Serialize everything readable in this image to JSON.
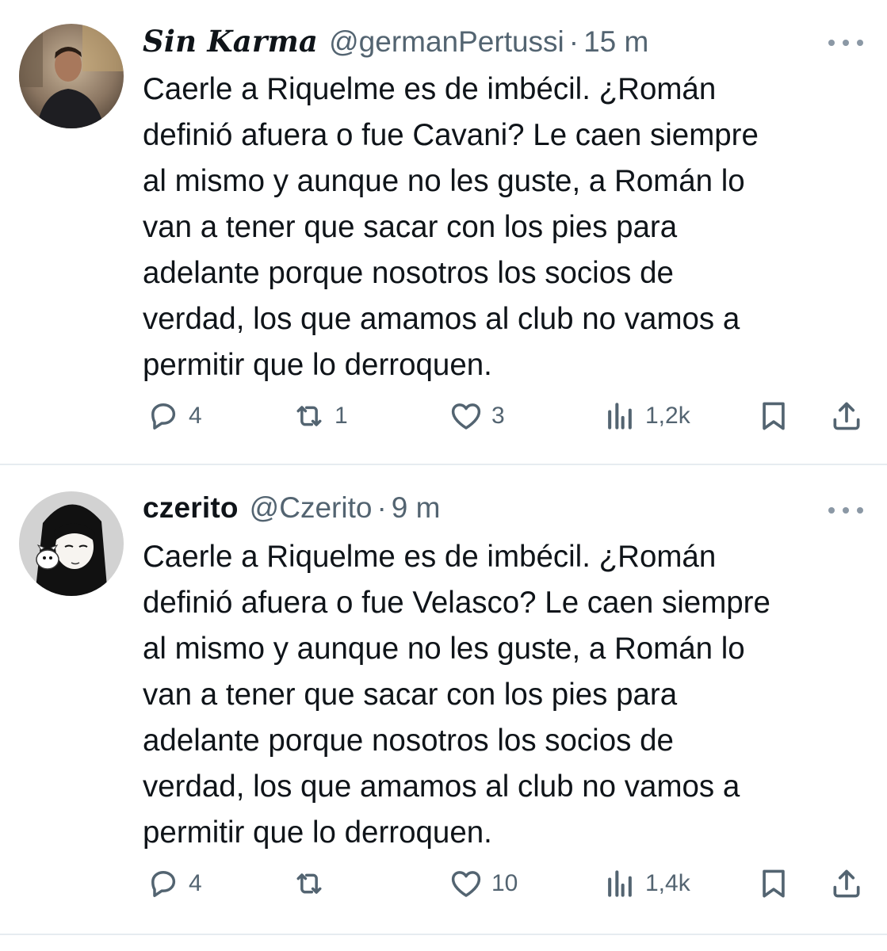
{
  "tweets": [
    {
      "display_name": "Sin Karma",
      "handle": "@germanPertussi",
      "separator": "·",
      "time": "15 m",
      "lines": [
        "Caerle a Riquelme es de imbécil. ¿Román",
        "definió afuera o fue Cavani? Le caen siempre",
        "al mismo y aunque no les guste, a Román lo",
        "van a tener que sacar con los pies para",
        "adelante porque nosotros los socios de",
        "verdad, los que amamos al club no vamos a",
        "permitir que lo derroquen."
      ],
      "replies": "4",
      "retweets": "1",
      "likes": "3",
      "views": "1,2k"
    },
    {
      "display_name": "czerito",
      "handle": "@Czerito",
      "separator": "·",
      "time": "9 m",
      "lines": [
        "Caerle a Riquelme es de imbécil. ¿Román",
        "definió afuera o fue Velasco? Le caen siempre",
        "al mismo y aunque no les guste, a Román lo",
        "van a tener que sacar con los pies para",
        "adelante porque nosotros los socios de",
        "verdad, los que amamos al club no vamos a",
        "permitir que lo derroquen."
      ],
      "replies": "4",
      "retweets": "",
      "likes": "10",
      "views": "1,4k"
    }
  ],
  "icons": {
    "reply": "reply-icon",
    "retweet": "retweet-icon",
    "like": "heart-icon",
    "views": "views-chart-icon",
    "bookmark": "bookmark-icon",
    "share": "share-icon",
    "more": "more-dots-icon"
  },
  "colors": {
    "text": "#0f1419",
    "secondary": "#536471",
    "divider": "#e6ecf0"
  }
}
